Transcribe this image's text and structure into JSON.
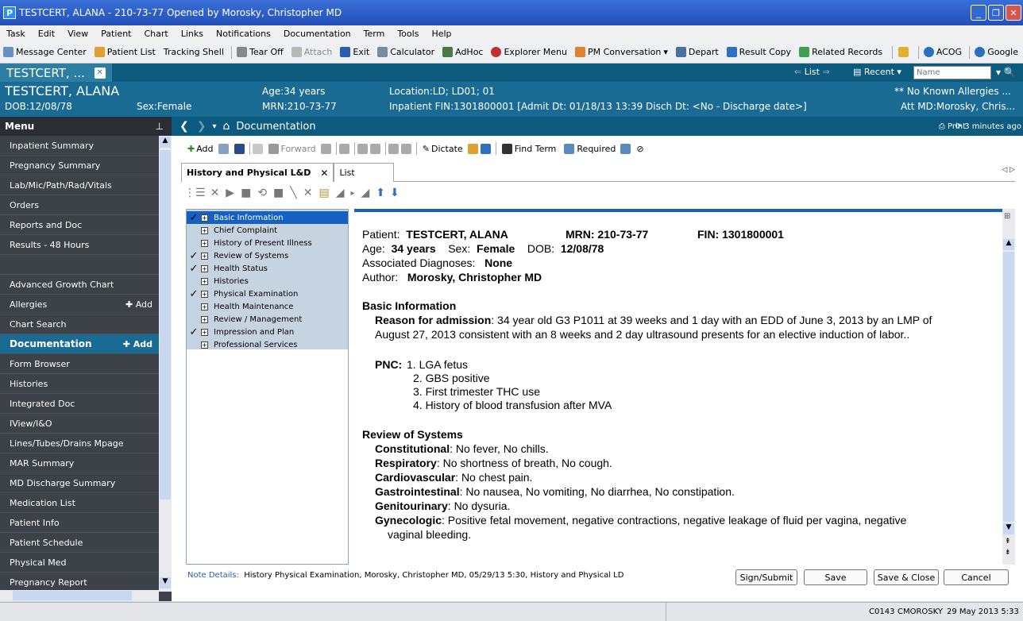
{
  "window": {
    "app_letter": "P",
    "title": "TESTCERT, ALANA - 210-73-77 Opened by Morosky, Christopher MD"
  },
  "menubar": [
    "Task",
    "Edit",
    "View",
    "Patient",
    "Chart",
    "Links",
    "Notifications",
    "Documentation",
    "Term",
    "Tools",
    "Help"
  ],
  "toolbar": {
    "message_center": "Message Center",
    "patient_list": "Patient List",
    "tracking_shell": "Tracking Shell",
    "tear_off": "Tear Off",
    "attach": "Attach",
    "exit": "Exit",
    "calculator": "Calculator",
    "adhoc": "AdHoc",
    "explorer_menu": "Explorer Menu",
    "pm_conversation": "PM Conversation",
    "depart": "Depart",
    "result_copy": "Result Copy",
    "related_records": "Related Records",
    "acog": "ACOG",
    "google": "Google"
  },
  "patient_tab": {
    "label": "TESTCERT, ...",
    "list": "List",
    "recent": "Recent",
    "name_placeholder": "Name"
  },
  "banner": {
    "name": "TESTCERT, ALANA",
    "dob": "DOB:12/08/78",
    "sex": "Sex:Female",
    "age": "Age:34 years",
    "mrn": "MRN:210-73-77",
    "location": "Location:LD; LD01; 01",
    "fin": "Inpatient FIN:1301800001 [Admit Dt: 01/18/13 13:39 Disch Dt: <No - Discharge date>]",
    "allergies": "** No Known Allergies ...",
    "att_md": "Att MD:Morosky, Chris..."
  },
  "left_menu": {
    "header": "Menu",
    "add_label": "Add",
    "items": [
      "Inpatient Summary",
      "Pregnancy Summary",
      "Lab/Mic/Path/Rad/Vitals",
      "Orders",
      "Reports and Doc",
      "Results - 48 Hours",
      "",
      "Advanced Growth Chart",
      "Allergies",
      "Chart Search",
      "Documentation",
      "Form Browser",
      "Histories",
      "Integrated Doc",
      "IView/I&O",
      "Lines/Tubes/Drains Mpage",
      "MAR Summary",
      "MD Discharge Summary",
      "Medication List",
      "Patient Info",
      "Patient Schedule",
      "Physical Med",
      "Pregnancy Report"
    ]
  },
  "doc_header": {
    "title": "Documentation",
    "print": "Print",
    "updated": "3 minutes ago"
  },
  "doc_toolbar": {
    "add": "Add",
    "forward": "Forward",
    "dictate": "Dictate",
    "find_term": "Find Term",
    "required": "Required"
  },
  "tabs": {
    "active": "History and Physical L&D",
    "list": "List"
  },
  "tree": [
    {
      "label": "Basic Information",
      "checked": true,
      "selected": true
    },
    {
      "label": "Chief Complaint",
      "checked": false
    },
    {
      "label": "History of Present Illness",
      "checked": false
    },
    {
      "label": "Review of Systems",
      "checked": true
    },
    {
      "label": "Health Status",
      "checked": true
    },
    {
      "label": "Histories",
      "checked": false
    },
    {
      "label": "Physical Examination",
      "checked": true
    },
    {
      "label": "Health Maintenance",
      "checked": false
    },
    {
      "label": "Review / Management",
      "checked": false
    },
    {
      "label": "Impression and Plan",
      "checked": true
    },
    {
      "label": "Professional Services",
      "checked": false
    }
  ],
  "document": {
    "patient_label": "Patient:",
    "patient": "TESTCERT, ALANA",
    "mrn": "MRN: 210-73-77",
    "fin": "FIN: 1301800001",
    "age_label": "Age:",
    "age": "34 years",
    "sex_label": "Sex:",
    "sex": "Female",
    "dob_label": "DOB:",
    "dob": "12/08/78",
    "diag_label": "Associated Diagnoses:",
    "diag": "None",
    "author_label": "Author:",
    "author": "Morosky, Christopher MD",
    "basic_info": "Basic Information",
    "reason_label": "Reason for admission",
    "reason_line1": ":  34 year old G3 P1011 at 39 weeks and 1 day with an EDD of June 3, 2013 by an LMP of",
    "reason_line2": "August 27, 2013 consistent with an 8 weeks and 2 day ultrasound presents for an elective induction of labor..",
    "pnc_label": "PNC:",
    "pnc": [
      "1. LGA fetus",
      "2. GBS positive",
      "3. First trimester THC use",
      "4. History of blood transfusion after MVA"
    ],
    "ros": "Review of Systems",
    "ros_items": [
      {
        "label": "Constitutional",
        "text": ":  No fever, No chills."
      },
      {
        "label": "Respiratory",
        "text": ":  No shortness of breath, No cough."
      },
      {
        "label": "Cardiovascular",
        "text": ":  No chest pain."
      },
      {
        "label": "Gastrointestinal",
        "text": ":  No nausea, No vomiting, No diarrhea, No constipation."
      },
      {
        "label": "Genitourinary",
        "text": ":  No dysuria."
      },
      {
        "label": "Gynecologic",
        "text": ":  Positive fetal movement, negative contractions, negative leakage of fluid per vagina, negative"
      }
    ],
    "gyn_cont": "vaginal bleeding."
  },
  "note_details": {
    "label": "Note Details:",
    "text": "History  Physical Examination, Morosky, Christopher MD, 05/29/13 5:30,  History and Physical LD"
  },
  "buttons": {
    "sign": "Sign/Submit",
    "save": "Save",
    "save_close": "Save & Close",
    "cancel": "Cancel"
  },
  "status": {
    "code": "C0143",
    "user": "CMOROSKY",
    "datetime": "29 May 2013  5:33"
  }
}
